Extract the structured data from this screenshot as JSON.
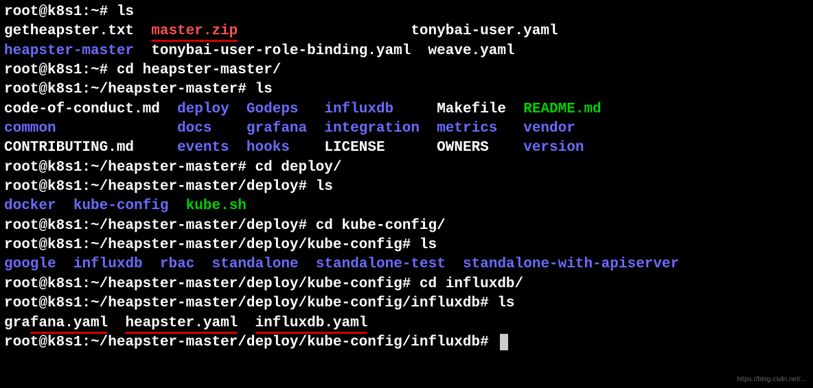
{
  "lines": {
    "l1_prompt": "root@k8s1:~# ",
    "l1_cmd": "ls",
    "l2_f1": "getheapster.txt",
    "l2_f2": "master.zip",
    "l2_f3": "tonybai-user.yaml",
    "l3_f1": "heapster-master",
    "l3_f2": "tonybai-user-role-binding.yaml",
    "l3_f3": "weave.yaml",
    "l4_prompt": "root@k8s1:~# ",
    "l4_cmd": "cd heapster-master/",
    "l5_prompt": "root@k8s1:~/heapster-master# ",
    "l5_cmd": "ls",
    "l6_f1": "code-of-conduct.md",
    "l6_f2": "deploy",
    "l6_f3": "Godeps",
    "l6_f4": "influxdb",
    "l6_f5": "Makefile",
    "l6_f6": "README.md",
    "l7_f1": "common",
    "l7_f2": "docs",
    "l7_f3": "grafana",
    "l7_f4": "integration",
    "l7_f5": "metrics",
    "l7_f6": "vendor",
    "l8_f1": "CONTRIBUTING.md",
    "l8_f2": "events",
    "l8_f3": "hooks",
    "l8_f4": "LICENSE",
    "l8_f5": "OWNERS",
    "l8_f6": "version",
    "l9_prompt": "root@k8s1:~/heapster-master# ",
    "l9_cmd": "cd deploy/",
    "l10_prompt": "root@k8s1:~/heapster-master/deploy# ",
    "l10_cmd": "ls",
    "l11_f1": "docker",
    "l11_f2": "kube-config",
    "l11_f3": "kube.sh",
    "l12_prompt": "root@k8s1:~/heapster-master/deploy# ",
    "l12_cmd": "cd kube-config/",
    "l13_prompt": "root@k8s1:~/heapster-master/deploy/kube-config# ",
    "l13_cmd": "ls",
    "l14_f1": "google",
    "l14_f2": "influxdb",
    "l14_f3": "rbac",
    "l14_f4": "standalone",
    "l14_f5": "standalone-test",
    "l14_f6": "standalone-with-apiserver",
    "l15_prompt": "root@k8s1:~/heapster-master/deploy/kube-config# ",
    "l15_cmd": "cd influxdb/",
    "l16_prompt": "root@k8s1:~/heapster-master/deploy/kube-config/influxdb# ",
    "l16_cmd": "ls",
    "l17_g1": "gra",
    "l17_g2": "fana.yaml",
    "l17_h1": "heapster.yaml",
    "l17_i1": "influxdb.yaml",
    "l18_prompt": "root@k8s1:~/heapster-master/deploy/kube-config/influxdb# "
  },
  "watermark": "https://blog.csdn.net/..."
}
